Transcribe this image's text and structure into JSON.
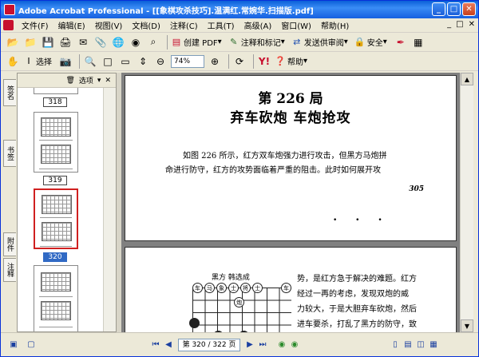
{
  "window": {
    "title": "Adobe Acrobat Professional - [[象棋攻杀技巧].温满红.常婉华.扫描版.pdf]",
    "controls": {
      "minimize": "_",
      "maximize": "□",
      "close": "✕"
    }
  },
  "menu": {
    "items": [
      "文件(F)",
      "编辑(E)",
      "视图(V)",
      "文档(D)",
      "注释(C)",
      "工具(T)",
      "高级(A)",
      "窗口(W)",
      "帮助(H)"
    ],
    "right_controls": [
      "_",
      "□",
      "✕"
    ]
  },
  "toolbar1": {
    "create_pdf": "创建 PDF",
    "comment_markup": "注释和标记",
    "send_review": "发送供审阅",
    "security": "安全"
  },
  "toolbar2": {
    "select": "选择",
    "zoom_value": "74%",
    "help": "帮助"
  },
  "nav": {
    "tabs": [
      "签名",
      "书签",
      "附件",
      "注释"
    ],
    "options_label": "选项",
    "page_labels": [
      "318",
      "319",
      "320"
    ],
    "selected_page": "320"
  },
  "document": {
    "page1": {
      "chapter_number": "第 226 局",
      "chapter_title": "弃车砍炮   车炮抢攻",
      "para_line1": "如图 226 所示，红方双车炮强力进行攻击，但黑方马炮拼",
      "para_line2": "命进行防守，红方的攻势面临着严重的阻击。此时如何展开攻",
      "page_number": "305",
      "marks": "• • •"
    },
    "page2": {
      "board_header": "黑方    韩选成",
      "para_line1": "势，是红方急于解决的难题。红方",
      "para_line2": "经过一再的考虑，发现双炮的威",
      "para_line3": "力较大，于是大胆弃车砍炮，然后",
      "para_line4": "进车要杀，打乱了黑方的防守，致",
      "pieces": [
        "车",
        "马",
        "象",
        "士",
        "将",
        "士",
        "车",
        "炮"
      ]
    }
  },
  "status": {
    "page_indicator": "第 320 / 322 页"
  }
}
